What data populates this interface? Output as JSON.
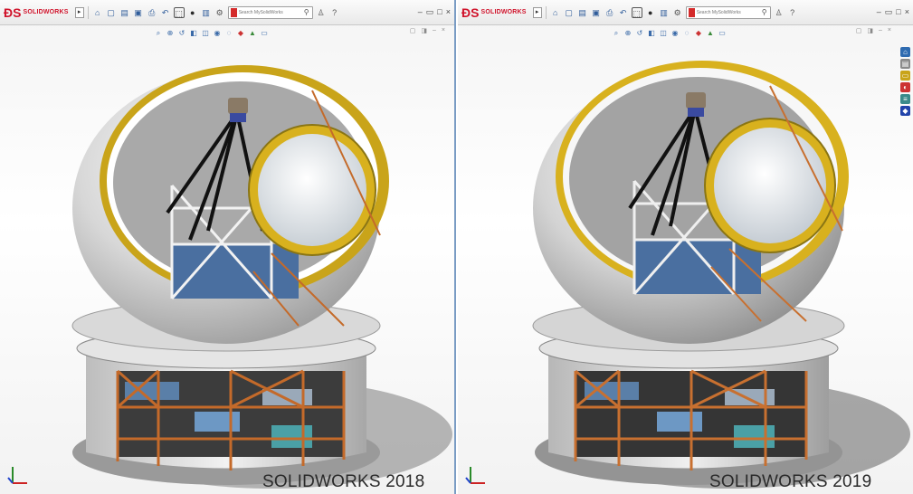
{
  "panes": [
    {
      "logo_text": "SOLIDWORKS",
      "search_placeholder": "Search MySolidWorks",
      "caption": "SOLIDWORKS 2018"
    },
    {
      "logo_text": "SOLIDWORKS",
      "search_placeholder": "Search MySolidWorks",
      "caption": "SOLIDWORKS 2019"
    }
  ],
  "colors": {
    "brand_red": "#d0142c",
    "divider_blue": "#7a9cc4",
    "rim_gold_2018": "#c9a41a",
    "rim_gold_2019": "#d8b11e",
    "steel_orange": "#c46a2a"
  },
  "toolbar_icons": [
    "home-icon",
    "new-icon",
    "open-icon",
    "save-icon",
    "print-icon",
    "undo-icon",
    "select-icon",
    "rebuild-icon",
    "file-props-icon",
    "options-icon",
    "help-icon"
  ],
  "view_icons": [
    "zoom-fit-icon",
    "zoom-area-icon",
    "previous-view-icon",
    "section-view-icon",
    "view-orientation-icon",
    "display-style-icon",
    "hide-show-icon",
    "edit-appearance-icon",
    "scene-icon",
    "display-icon"
  ],
  "task_icons": [
    "resources-icon",
    "design-library-icon",
    "file-explorer-icon",
    "appearances-icon",
    "custom-props-icon",
    "solidworks-forum-icon"
  ]
}
